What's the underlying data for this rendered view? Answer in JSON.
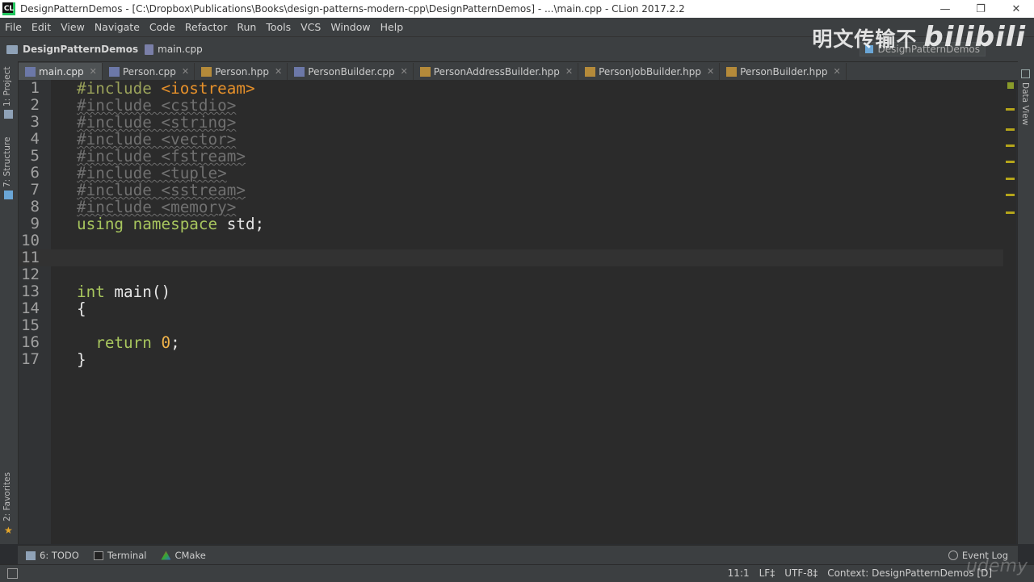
{
  "window": {
    "app_icon_text": "CL",
    "title": "DesignPatternDemos - [C:\\Dropbox\\Publications\\Books\\design-patterns-modern-cpp\\DesignPatternDemos] - ...\\main.cpp - CLion 2017.2.2",
    "minimize_glyph": "—",
    "restore_glyph": "❐",
    "close_glyph": "✕"
  },
  "menu": [
    {
      "label": "File"
    },
    {
      "label": "Edit"
    },
    {
      "label": "View"
    },
    {
      "label": "Navigate"
    },
    {
      "label": "Code"
    },
    {
      "label": "Refactor"
    },
    {
      "label": "Run"
    },
    {
      "label": "Tools"
    },
    {
      "label": "VCS"
    },
    {
      "label": "Window"
    },
    {
      "label": "Help"
    }
  ],
  "navbar": {
    "project": "DesignPatternDemos",
    "file": "main.cpp",
    "run_config": "DesignPatternDemos"
  },
  "watermark": {
    "text": "明文传输不",
    "brand": "bilibili"
  },
  "left_tools": {
    "project": "1: Project",
    "structure": "7: Structure",
    "favorites": "2: Favorites"
  },
  "right_tools": {
    "data_view": "Data View"
  },
  "tabs": [
    {
      "label": "main.cpp",
      "kind": "cpp",
      "active": true
    },
    {
      "label": "Person.cpp",
      "kind": "cpp",
      "active": false
    },
    {
      "label": "Person.hpp",
      "kind": "hpp",
      "active": false
    },
    {
      "label": "PersonBuilder.cpp",
      "kind": "cpp",
      "active": false
    },
    {
      "label": "PersonAddressBuilder.hpp",
      "kind": "hpp",
      "active": false
    },
    {
      "label": "PersonJobBuilder.hpp",
      "kind": "hpp",
      "active": false
    },
    {
      "label": "PersonBuilder.hpp",
      "kind": "hpp",
      "active": false
    }
  ],
  "editor": {
    "current_line": 11,
    "lines": [
      {
        "n": "1",
        "tokens": [
          {
            "t": "#include ",
            "c": "dir"
          },
          {
            "t": "<iostream>",
            "c": "hdr"
          }
        ]
      },
      {
        "n": "2",
        "tokens": [
          {
            "t": "#include <cstdio>",
            "c": "dim"
          }
        ]
      },
      {
        "n": "3",
        "tokens": [
          {
            "t": "#include <string>",
            "c": "dim"
          }
        ]
      },
      {
        "n": "4",
        "tokens": [
          {
            "t": "#include <vector>",
            "c": "dim"
          }
        ]
      },
      {
        "n": "5",
        "tokens": [
          {
            "t": "#include <fstream>",
            "c": "dim"
          }
        ]
      },
      {
        "n": "6",
        "tokens": [
          {
            "t": "#include <tuple>",
            "c": "dim"
          }
        ]
      },
      {
        "n": "7",
        "tokens": [
          {
            "t": "#include <sstream>",
            "c": "dim"
          }
        ]
      },
      {
        "n": "8",
        "tokens": [
          {
            "t": "#include <memory>",
            "c": "dim"
          }
        ]
      },
      {
        "n": "9",
        "tokens": [
          {
            "t": "using namespace",
            "c": "kw"
          },
          {
            "t": " std;",
            "c": "plain"
          }
        ]
      },
      {
        "n": "10",
        "tokens": []
      },
      {
        "n": "11",
        "tokens": []
      },
      {
        "n": "12",
        "tokens": []
      },
      {
        "n": "13",
        "tokens": [
          {
            "t": "int",
            "c": "kw"
          },
          {
            "t": " main()",
            "c": "plain"
          }
        ]
      },
      {
        "n": "14",
        "tokens": [
          {
            "t": "{",
            "c": "plain"
          }
        ]
      },
      {
        "n": "15",
        "tokens": []
      },
      {
        "n": "16",
        "tokens": [
          {
            "t": "  ",
            "c": "plain"
          },
          {
            "t": "return",
            "c": "kw"
          },
          {
            "t": " ",
            "c": "plain"
          },
          {
            "t": "0",
            "c": "num"
          },
          {
            "t": ";",
            "c": "plain"
          }
        ]
      },
      {
        "n": "17",
        "tokens": [
          {
            "t": "}",
            "c": "plain"
          }
        ]
      }
    ]
  },
  "bottom_tools": {
    "todo": "6: TODO",
    "terminal": "Terminal",
    "cmake": "CMake",
    "event_log": "Event Log"
  },
  "status": {
    "position": "11:1",
    "line_sep": "LF‡",
    "encoding": "UTF-8‡",
    "context": "Context: DesignPatternDemos [D]"
  },
  "overlay": {
    "udemy": "udemy"
  },
  "colors": {
    "editor_bg": "#2b2b2b",
    "keyword": "#a8c65e",
    "header_string": "#e6902a",
    "unused_include": "#707070",
    "number": "#f0b34a",
    "marker": "#b5a51a"
  }
}
